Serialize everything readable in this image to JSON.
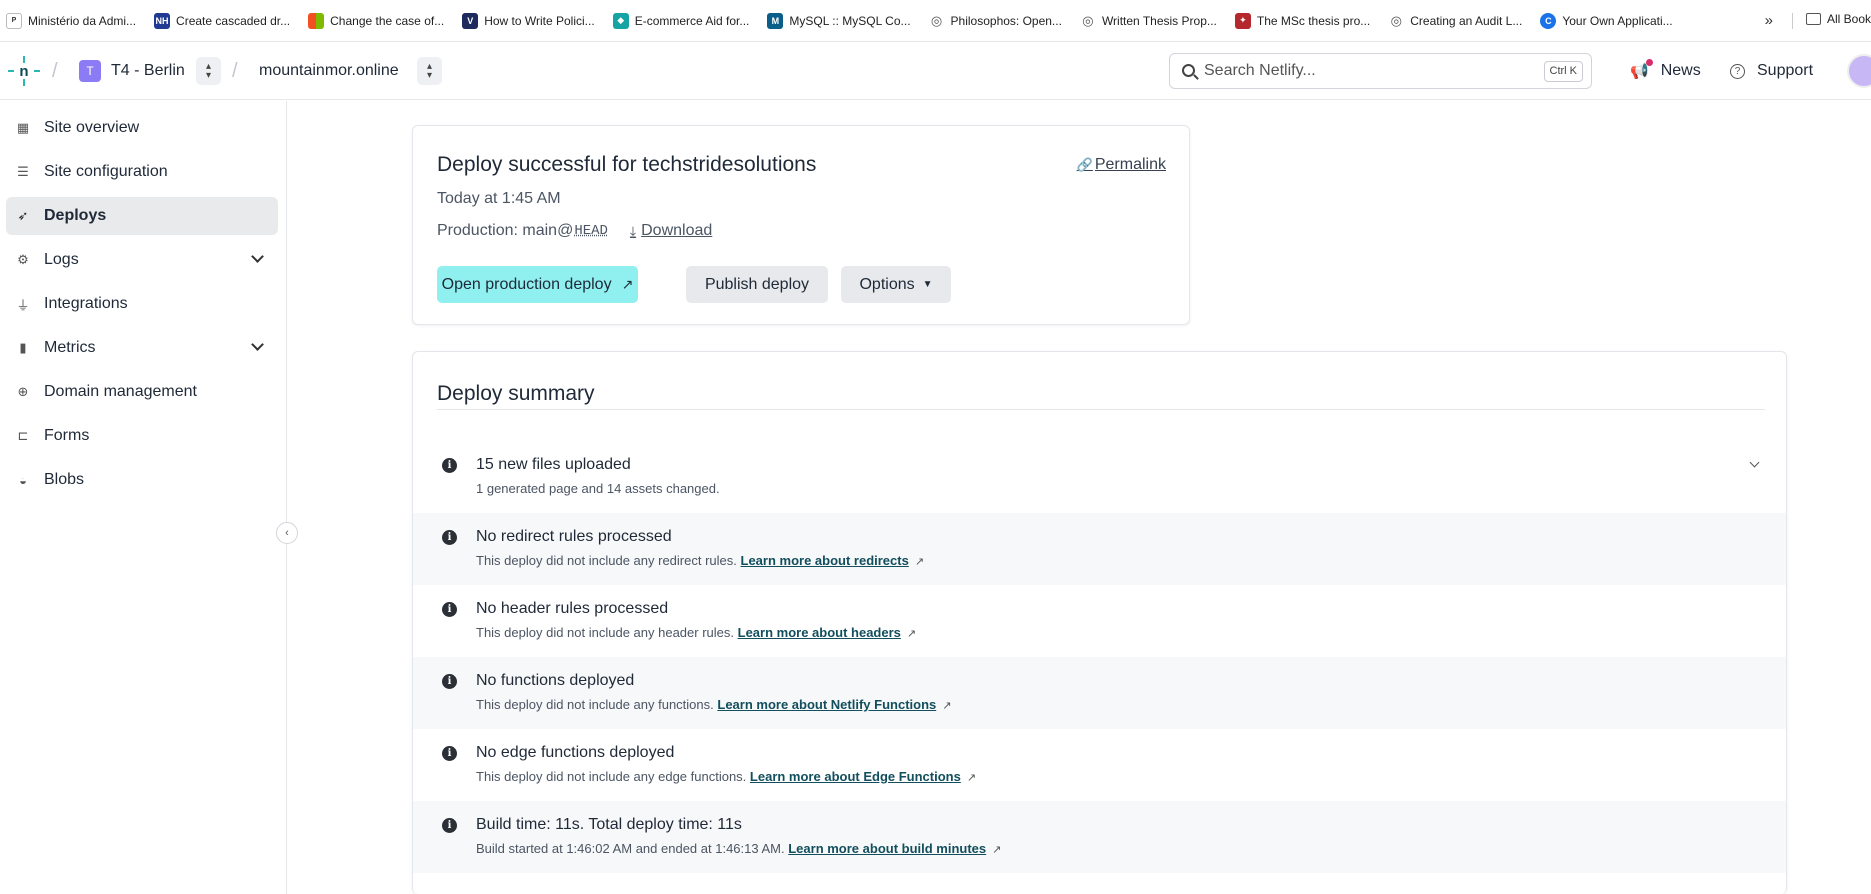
{
  "bookmarks": {
    "items": [
      {
        "label": "Ministério da Admi...",
        "icon": "portal-icon",
        "color": "#333"
      },
      {
        "label": "Create cascaded dr...",
        "icon": "nh-icon",
        "color": "#1f3a93"
      },
      {
        "label": "Change the case of...",
        "icon": "microsoft-icon",
        "color": "#f25022"
      },
      {
        "label": "How to Write Polici...",
        "icon": "bookmark-v-icon",
        "color": "#1c2a5e"
      },
      {
        "label": "E-commerce Aid for...",
        "icon": "ecommerce-icon",
        "color": "#16a3a3"
      },
      {
        "label": "MySQL :: MySQL Co...",
        "icon": "mysql-icon",
        "color": "#0b5e8a"
      },
      {
        "label": "Philosophos: Open...",
        "icon": "globe-icon",
        "color": "#555"
      },
      {
        "label": "Written Thesis Prop...",
        "icon": "globe-icon",
        "color": "#555"
      },
      {
        "label": "The MSc thesis pro...",
        "icon": "shield-crest-icon",
        "color": "#b5282e"
      },
      {
        "label": "Creating an Audit L...",
        "icon": "globe-icon",
        "color": "#555"
      },
      {
        "label": "Your Own Applicati...",
        "icon": "c-circle-icon",
        "color": "#1a73e8"
      }
    ],
    "more": "»",
    "all_label": "All Book"
  },
  "header": {
    "team_initial": "T",
    "team_name": "T4 - Berlin",
    "site_name": "mountainmor.online",
    "search_placeholder": "Search Netlify...",
    "search_shortcut": "Ctrl K",
    "news_label": "News",
    "support_label": "Support"
  },
  "sidebar": {
    "items": [
      {
        "label": "Site overview",
        "icon": "grid-icon"
      },
      {
        "label": "Site configuration",
        "icon": "config-icon"
      },
      {
        "label": "Deploys",
        "icon": "rocket-icon"
      },
      {
        "label": "Logs",
        "icon": "logs-icon"
      },
      {
        "label": "Integrations",
        "icon": "plug-icon"
      },
      {
        "label": "Metrics",
        "icon": "bar-chart-icon"
      },
      {
        "label": "Domain management",
        "icon": "globe-icon"
      },
      {
        "label": "Forms",
        "icon": "form-icon"
      },
      {
        "label": "Blobs",
        "icon": "blob-icon"
      }
    ]
  },
  "deploy": {
    "title": "Deploy successful for techstridesolutions",
    "permalink": "Permalink",
    "time": "Today at 1:45 AM",
    "production_prefix": "Production: main@",
    "production_ref": "HEAD",
    "download": "Download",
    "btn_open": "Open production deploy",
    "btn_publish": "Publish deploy",
    "btn_options": "Options"
  },
  "summary": {
    "title": "Deploy summary",
    "rows": [
      {
        "title": "15 new files uploaded",
        "desc": "1 generated page and 14 assets changed.",
        "link": ""
      },
      {
        "title": "No redirect rules processed",
        "desc": "This deploy did not include any redirect rules.",
        "link": "Learn more about redirects"
      },
      {
        "title": "No header rules processed",
        "desc": "This deploy did not include any header rules.",
        "link": "Learn more about headers"
      },
      {
        "title": "No functions deployed",
        "desc": "This deploy did not include any functions.",
        "link": "Learn more about Netlify Functions"
      },
      {
        "title": "No edge functions deployed",
        "desc": "This deploy did not include any edge functions.",
        "link": "Learn more about Edge Functions"
      },
      {
        "title": "Build time: 11s. Total deploy time: 11s",
        "desc": "Build started at 1:46:02 AM and ended at 1:46:13 AM.",
        "link": "Learn more about build minutes"
      }
    ]
  }
}
